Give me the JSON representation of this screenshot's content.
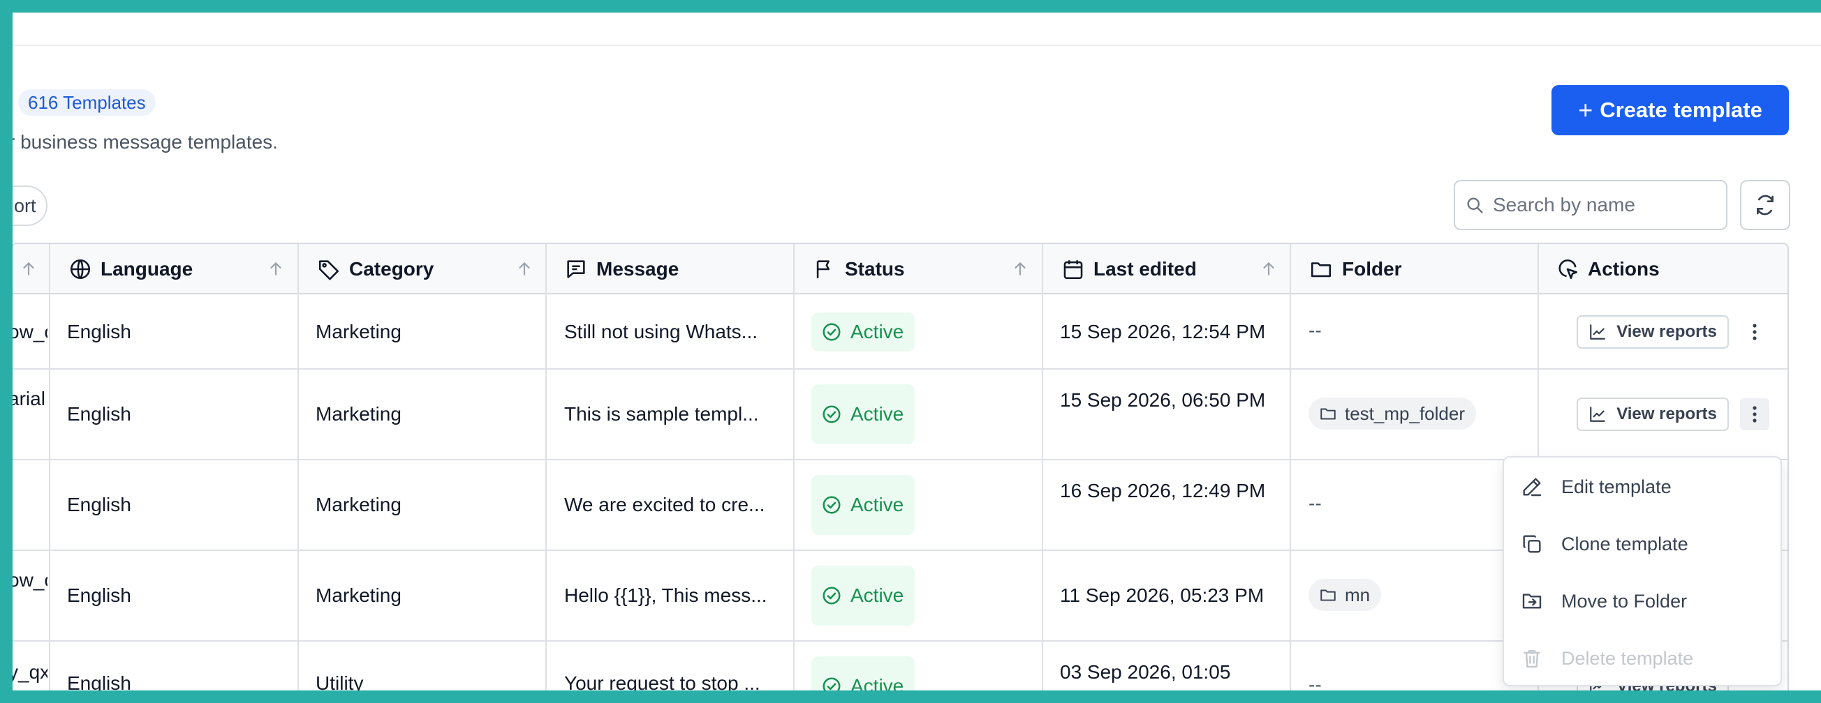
{
  "header": {
    "count_badge": "616 Templates",
    "subtitle": "r business message templates.",
    "create_button": "Create template",
    "export_label": "ort"
  },
  "search": {
    "placeholder": "Search by name"
  },
  "table": {
    "columns": {
      "name_fragment": "",
      "language": "Language",
      "category": "Category",
      "message": "Message",
      "status": "Status",
      "last_edited": "Last edited",
      "folder": "Folder",
      "actions": "Actions"
    },
    "rows": [
      {
        "name_fragment": "ow_c",
        "language": "English",
        "category": "Marketing",
        "message": "Still not using Whats...",
        "status": "Active",
        "last_edited": "15 Sep 2026, 12:54 PM",
        "folder": "--"
      },
      {
        "name_fragment": "arial",
        "language": "English",
        "category": "Marketing",
        "message": "This is sample templ...",
        "status": "Active",
        "last_edited": "15 Sep 2026, 06:50 PM",
        "folder": "test_mp_folder"
      },
      {
        "name_fragment": "",
        "language": "English",
        "category": "Marketing",
        "message": "We are excited to cre...",
        "status": "Active",
        "last_edited": "16 Sep 2026, 12:49 PM",
        "folder": "--"
      },
      {
        "name_fragment": "ow_c",
        "language": "English",
        "category": "Marketing",
        "message": "Hello {{1}}, This mess...",
        "status": "Active",
        "last_edited": "11 Sep 2026, 05:23 PM",
        "folder": "mn"
      },
      {
        "name_fragment": "y_qx",
        "language": "English",
        "category": "Utility",
        "message": "Your request to stop ...",
        "status": "Active",
        "last_edited": "03 Sep 2026, 01:05",
        "folder": "--"
      }
    ],
    "view_reports_label": "View reports"
  },
  "context_menu": {
    "items": [
      {
        "label": "Edit template",
        "icon": "pen-icon",
        "disabled": false
      },
      {
        "label": "Clone template",
        "icon": "copy-icon",
        "disabled": false
      },
      {
        "label": "Move to Folder",
        "icon": "folder-move-icon",
        "disabled": false
      },
      {
        "label": "Delete template",
        "icon": "trash-icon",
        "disabled": true
      }
    ]
  },
  "colors": {
    "primary": "#1a5ff0",
    "active_text": "#16914f",
    "active_bg": "#ecfbf2",
    "frame": "#2aaea8"
  }
}
